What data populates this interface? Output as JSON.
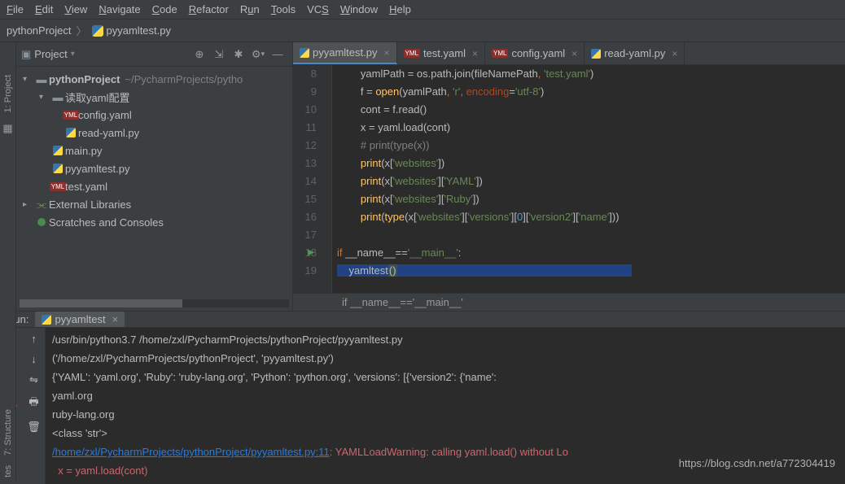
{
  "menu": [
    "File",
    "Edit",
    "View",
    "Navigate",
    "Code",
    "Refactor",
    "Run",
    "Tools",
    "VCS",
    "Window",
    "Help"
  ],
  "nav": {
    "project": "pythonProject",
    "file": "pyyamltest.py"
  },
  "project_panel": {
    "title": "Project",
    "root": {
      "name": "pythonProject",
      "path": "~/PycharmProjects/pytho"
    },
    "folder": "读取yaml配置",
    "files_in_folder": [
      "config.yaml",
      "read-yaml.py"
    ],
    "files_root": [
      "main.py",
      "pyyamltest.py",
      "test.yaml"
    ],
    "external": "External Libraries",
    "scratch": "Scratches and Consoles"
  },
  "tabs": [
    {
      "name": "pyyamltest.py",
      "type": "py",
      "active": true
    },
    {
      "name": "test.yaml",
      "type": "yaml",
      "active": false
    },
    {
      "name": "config.yaml",
      "type": "yaml",
      "active": false
    },
    {
      "name": "read-yaml.py",
      "type": "py",
      "active": false
    }
  ],
  "code_lines": [
    8,
    9,
    10,
    11,
    12,
    13,
    14,
    15,
    16,
    17,
    18,
    19
  ],
  "breadcrumb_bottom": "if __name__=='__main__'",
  "run": {
    "label": "Run:",
    "tab": "pyyamltest",
    "lines": [
      "/usr/bin/python3.7 /home/zxl/PycharmProjects/pythonProject/pyyamltest.py",
      "('/home/zxl/PycharmProjects/pythonProject', 'pyyamltest.py')",
      "{'YAML': 'yaml.org', 'Ruby': 'ruby-lang.org', 'Python': 'python.org', 'versions': [{'version2': {'name':",
      "yaml.org",
      "ruby-lang.org",
      "<class 'str'>"
    ],
    "link": "/home/zxl/PycharmProjects/pythonProject/pyyamltest.py:11",
    "warn": ": YAMLLoadWarning: calling yaml.load() without Lo",
    "warn_code": "  x = yaml.load(cont)"
  },
  "watermark": "https://blog.csdn.net/a772304419",
  "sidebar_left": {
    "project": "1: Project",
    "structure": "7: Structure",
    "favorites": "tes"
  }
}
